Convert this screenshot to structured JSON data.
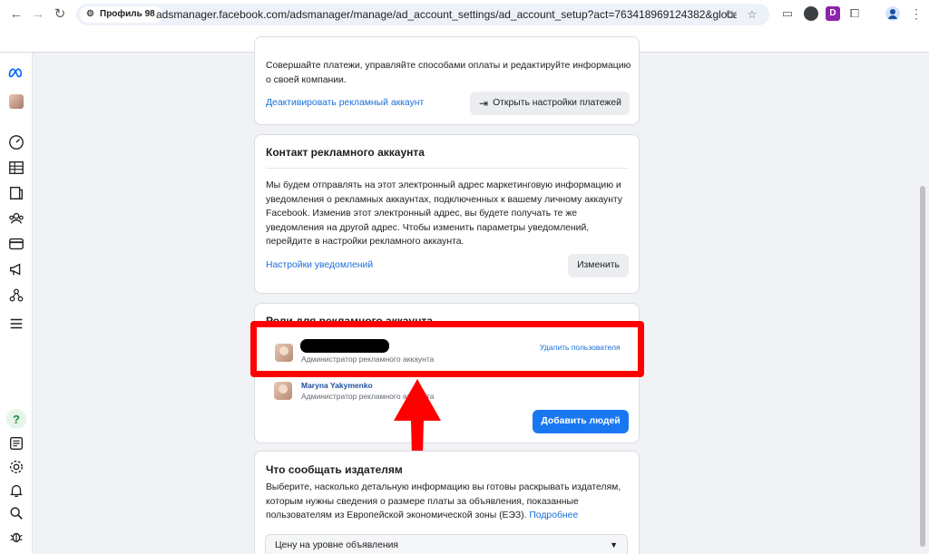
{
  "browser": {
    "profile": "Профиль 98",
    "url": "adsmanager.facebook.com/adsmanager/manage/ad_account_settings/ad_account_setup?act=763418969124382&global_scope_i..."
  },
  "payments_card": {
    "text": "Совершайте платежи, управляйте способами оплаты и редактируйте информацию о своей компании.",
    "deactivate_link": "Деактивировать рекламный аккаунт",
    "open_settings_button": "Открыть настройки платежей"
  },
  "contact_card": {
    "title": "Контакт рекламного аккаунта",
    "text": "Мы будем отправлять на этот электронный адрес маркетинговую информацию и уведомления о рекламных аккаунтах, подключенных к вашему личному аккаунту Facebook. Изменив этот электронный адрес, вы будете получать те же уведомления на другой адрес. Чтобы изменить параметры уведомлений, перейдите в настройки рекламного аккаунта.",
    "notifications_link": "Настройки уведомлений",
    "change_button": "Изменить"
  },
  "roles_card": {
    "title": "Роли для рекламного аккаунта",
    "users": [
      {
        "name": "",
        "role": "Администратор рекламного аккаунта",
        "action": "Удалить пользователя"
      },
      {
        "name": "Maryna Yakymenko",
        "role": "Администратор рекламного аккаунта"
      }
    ],
    "add_people_button": "Добавить людей"
  },
  "publishers_card": {
    "title": "Что сообщать издателям",
    "text": "Выберите, насколько детальную информацию вы готовы раскрывать издателям, которым нужны сведения о размере платы за объявления, показанные пользователям из Европейской экономической зоны (ЕЭЗ).",
    "more_link": "Подробнее",
    "select_value": "Цену на уровне объявления"
  },
  "colors": {
    "accent": "#1a77f2",
    "link": "#1a6ed8",
    "highlight": "#ff0000"
  }
}
